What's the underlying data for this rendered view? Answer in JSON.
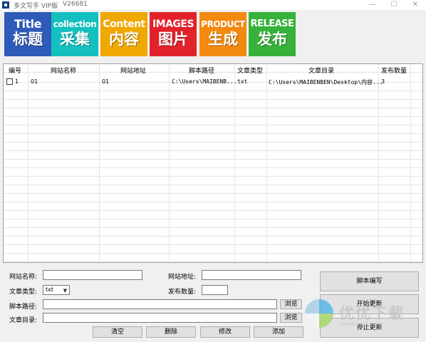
{
  "window": {
    "title": "多文写手 VIP版",
    "version": "V26681",
    "minimize_symbol": "—",
    "maximize_symbol": "☐",
    "close_symbol": "✕"
  },
  "toolbar": [
    {
      "en": "Title",
      "zh": "标题",
      "color": "#2e5bb8"
    },
    {
      "en": "collection",
      "zh": "采集",
      "color": "#14bfbf"
    },
    {
      "en": "Content",
      "zh": "内容",
      "color": "#f0a800"
    },
    {
      "en": "IMAGES",
      "zh": "图片",
      "color": "#e2222b"
    },
    {
      "en": "PRODUCT",
      "zh": "生成",
      "color": "#f28a10"
    },
    {
      "en": "RELEASE",
      "zh": "发布",
      "color": "#36b23a"
    }
  ],
  "table": {
    "columns": [
      "编号",
      "网站名称",
      "网站地址",
      "脚本路径",
      "文章类型",
      "文章目录",
      "发布数量"
    ],
    "rows": [
      [
        "1",
        "01",
        "01",
        "C:\\Users\\MAIBENB...",
        "txt",
        "C:\\Users\\MAIBENBEN\\Desktop\\内容...",
        "3"
      ]
    ]
  },
  "form": {
    "site_name_label": "网站名称:",
    "site_name_value": "",
    "site_url_label": "网站地址:",
    "site_url_value": "",
    "article_type_label": "文章类型:",
    "article_type_value": "txt",
    "publish_count_label": "发布数量:",
    "publish_count_value": "",
    "script_path_label": "脚本路径:",
    "script_path_value": "",
    "article_dir_label": "文章目录:",
    "article_dir_value": "",
    "browse_label": "浏览",
    "clear_label": "清空",
    "delete_label": "删除",
    "modify_label": "修改",
    "add_label": "添加"
  },
  "actions": {
    "script_edit_label": "脚本编写",
    "start_update_label": "开始更新",
    "stop_update_label": "停止更新"
  },
  "watermark": {
    "text": "优优下载",
    "url": "www.yyxt.com"
  }
}
